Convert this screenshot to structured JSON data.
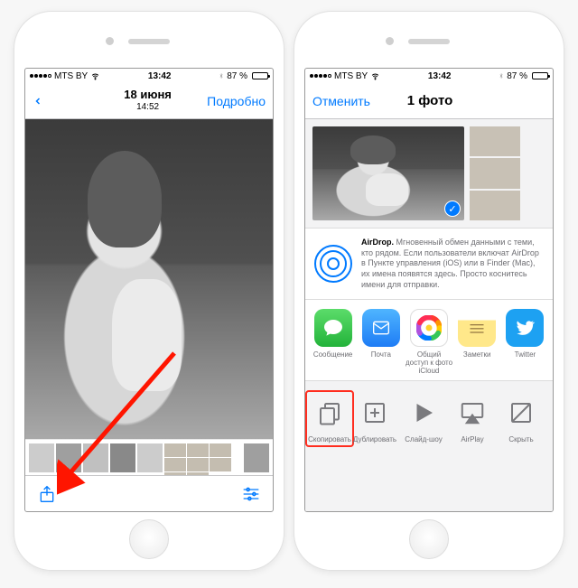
{
  "phone_left": {
    "status": {
      "carrier": "MTS BY",
      "time": "13:42",
      "battery": "87 %"
    },
    "nav": {
      "date": "18 июня",
      "time": "14:52",
      "details": "Подробно"
    }
  },
  "phone_right": {
    "status": {
      "carrier": "MTS BY",
      "time": "13:42",
      "battery": "87 %"
    },
    "nav": {
      "cancel": "Отменить",
      "title": "1 фото"
    },
    "airdrop": {
      "title": "AirDrop.",
      "body": "Мгновенный обмен данными с теми, кто рядом. Если пользователи включат AirDrop в Пункте управления (iOS) или в Finder (Mac), их имена появятся здесь. Просто коснитесь имени для отправки."
    },
    "apps": [
      {
        "label": "Сообщение"
      },
      {
        "label": "Почта"
      },
      {
        "label": "Общий доступ к фото iCloud"
      },
      {
        "label": "Заметки"
      },
      {
        "label": "Twitter"
      }
    ],
    "actions": [
      {
        "label": "Скопировать"
      },
      {
        "label": "Дублировать"
      },
      {
        "label": "Слайд-шоу"
      },
      {
        "label": "AirPlay"
      },
      {
        "label": "Скрыть"
      }
    ]
  }
}
